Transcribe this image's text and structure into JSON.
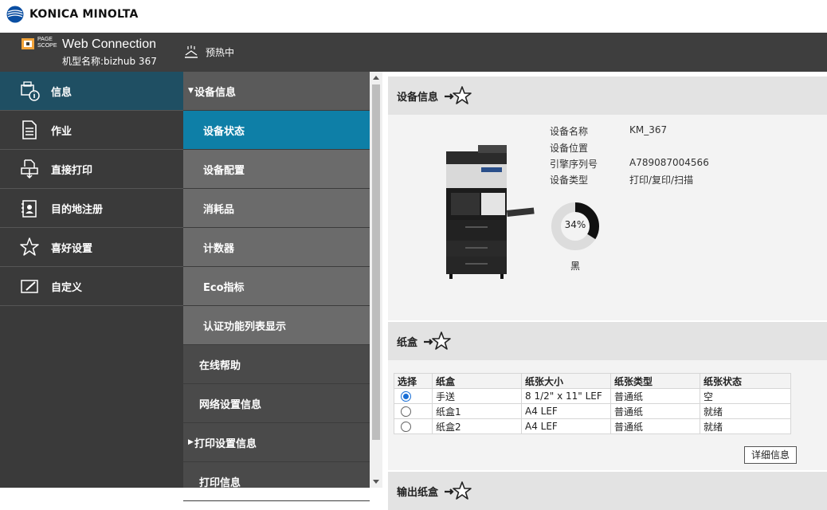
{
  "brand": {
    "name": "KONICA MINOLTA"
  },
  "header": {
    "logo_top": "PAGE",
    "logo_bottom": "SCOPE",
    "title": "Web Connection",
    "model_label": "机型名称:bizhub 367",
    "status": "预热中"
  },
  "nav": {
    "items": [
      {
        "label": "信息",
        "icon": "info-icon"
      },
      {
        "label": "作业",
        "icon": "document-icon"
      },
      {
        "label": "直接打印",
        "icon": "direct-print-icon"
      },
      {
        "label": "目的地注册",
        "icon": "address-book-icon"
      },
      {
        "label": "喜好设置",
        "icon": "star-icon"
      },
      {
        "label": "自定义",
        "icon": "edit-icon"
      }
    ]
  },
  "subnav": {
    "group": "设备信息",
    "children": [
      "设备状态",
      "设备配置",
      "消耗品",
      "计数器",
      "Eco指标",
      "认证功能列表显示"
    ],
    "others": [
      "在线帮助",
      "网络设置信息",
      "打印设置信息",
      "打印信息"
    ]
  },
  "device_section": {
    "title": "设备信息",
    "fields": [
      {
        "label": "设备名称",
        "value": "KM_367"
      },
      {
        "label": "设备位置",
        "value": ""
      },
      {
        "label": "引擎序列号",
        "value": "A789087004566"
      },
      {
        "label": "设备类型",
        "value": "打印/复印/扫描"
      }
    ],
    "toner": {
      "percent_label": "34%",
      "level": 0.34,
      "name": "黑"
    }
  },
  "tray_section": {
    "title": "纸盒",
    "columns": [
      "选择",
      "纸盒",
      "纸张大小",
      "纸张类型",
      "纸张状态"
    ],
    "rows": [
      {
        "selected": true,
        "tray": "手送",
        "size": "8 1/2\" x 11\" LEF",
        "type": "普通纸",
        "status": "空"
      },
      {
        "selected": false,
        "tray": "纸盒1",
        "size": "A4 LEF",
        "type": "普通纸",
        "status": "就绪"
      },
      {
        "selected": false,
        "tray": "纸盒2",
        "size": "A4 LEF",
        "type": "普通纸",
        "status": "就绪"
      }
    ],
    "detail_button": "详细信息"
  },
  "output_section": {
    "title": "输出纸盒"
  },
  "colors": {
    "accent": "#0e7fa7",
    "nav_active": "#1f4f63",
    "header": "#3e3e3e"
  }
}
